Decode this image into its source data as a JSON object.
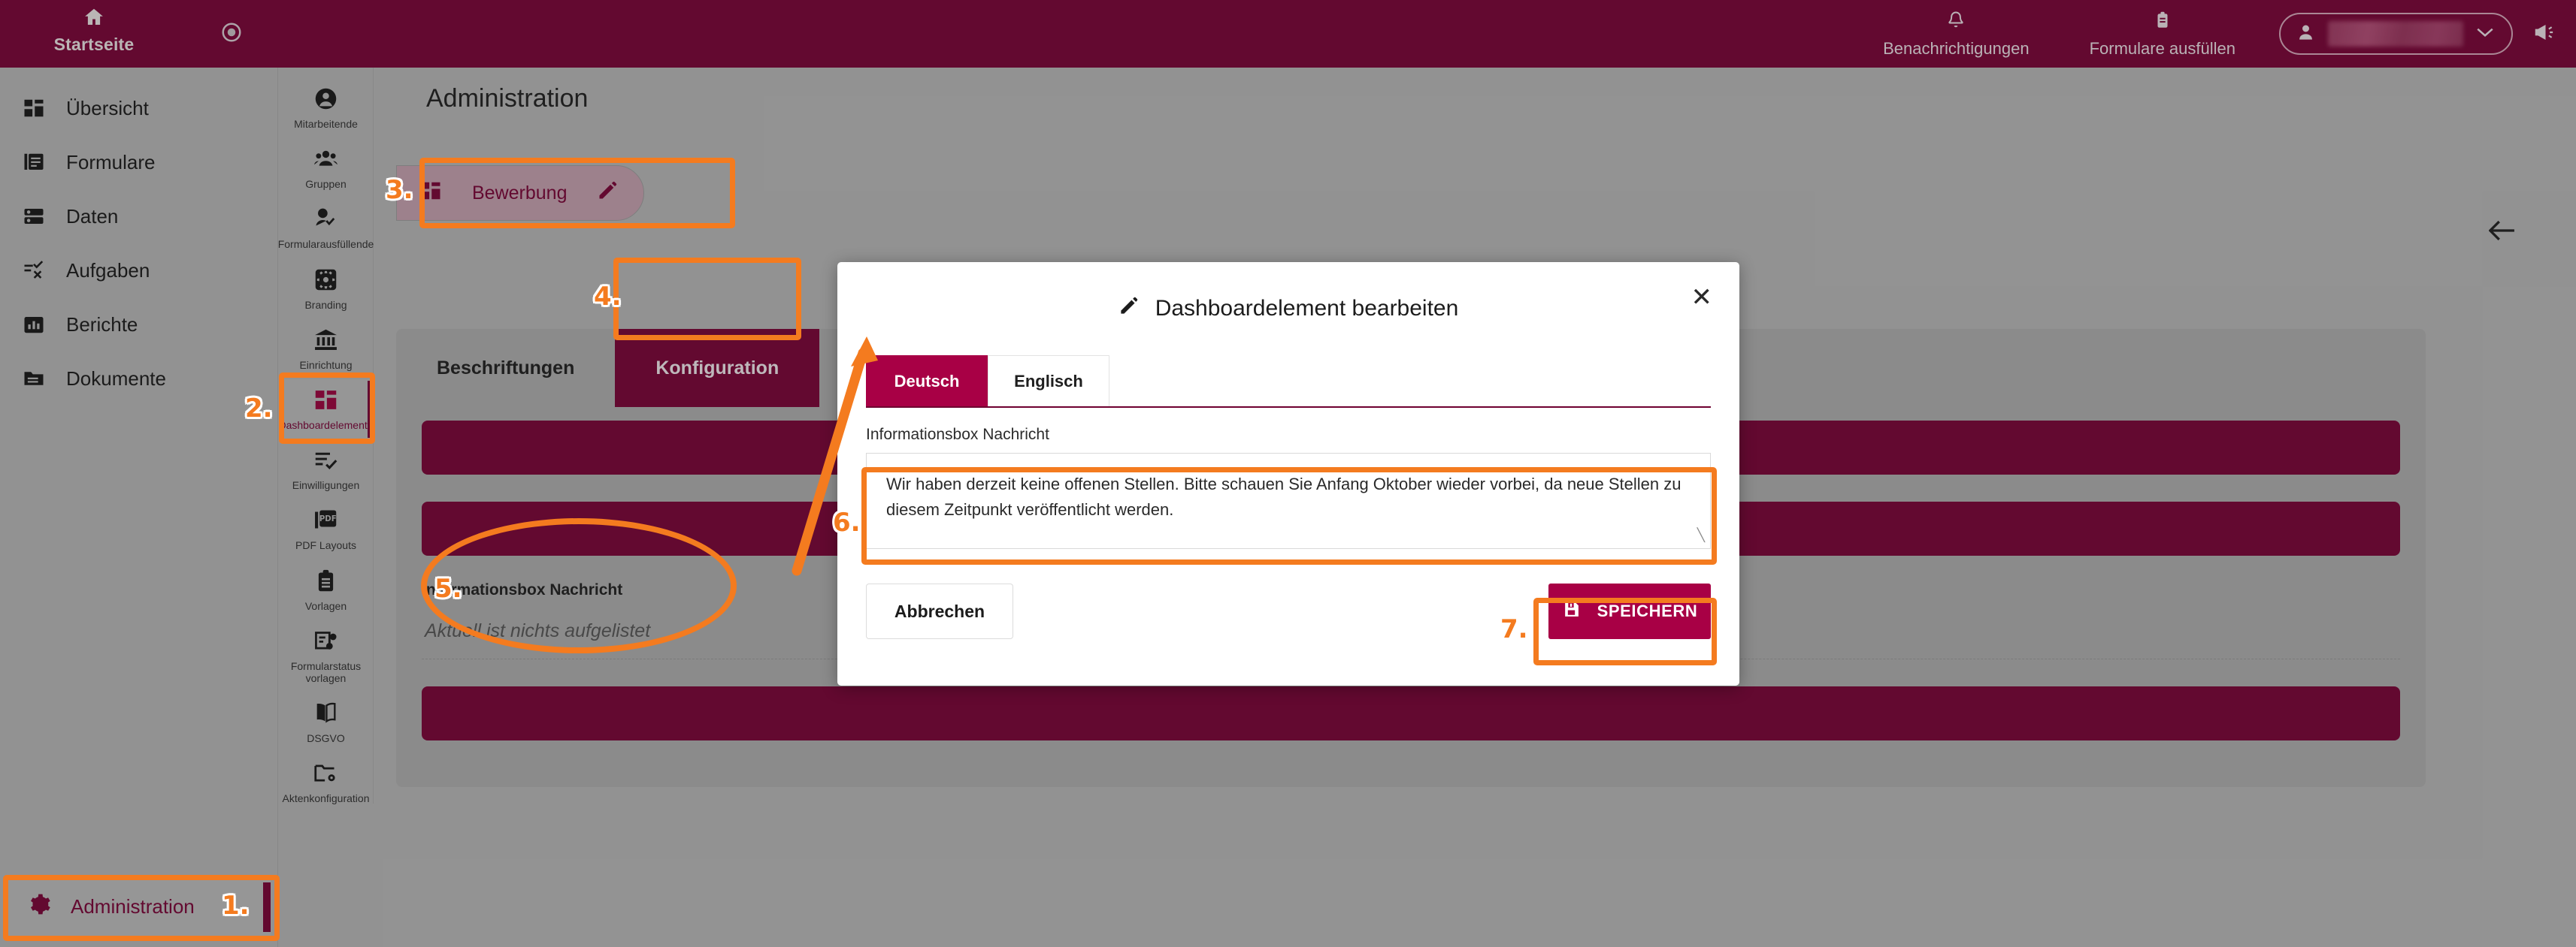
{
  "header": {
    "home_label": "Startseite",
    "target_icon": "target-icon",
    "notifications_label": "Benachrichtigungen",
    "notifications_icon": "bell-icon",
    "fill_forms_label": "Formulare ausfüllen",
    "fill_forms_icon": "clipboard-icon",
    "user_icon": "user-icon",
    "user_name": "",
    "user_chevron": "chevron-down-icon",
    "megaphone_icon": "megaphone-icon",
    "background_color": "#6e0030"
  },
  "sidebar": {
    "items": [
      {
        "label": "Übersicht",
        "icon": "dashboard-grid-icon"
      },
      {
        "label": "Formulare",
        "icon": "forms-icon"
      },
      {
        "label": "Daten",
        "icon": "database-icon"
      },
      {
        "label": "Aufgaben",
        "icon": "tasks-icon"
      },
      {
        "label": "Berichte",
        "icon": "chart-bar-icon"
      },
      {
        "label": "Dokumente",
        "icon": "folder-icon"
      }
    ],
    "admin": {
      "label": "Administration",
      "icon": "gear-icon",
      "active": true
    }
  },
  "icon_column": {
    "items": [
      {
        "label": "Mitarbeitende",
        "icon": "person-circle-icon",
        "active": false
      },
      {
        "label": "Gruppen",
        "icon": "group-icon",
        "active": false
      },
      {
        "label": "Formularausfüllende",
        "icon": "person-check-icon",
        "active": false
      },
      {
        "label": "Branding",
        "icon": "gear-square-icon",
        "active": false
      },
      {
        "label": "Einrichtung",
        "icon": "bank-icon",
        "active": false
      },
      {
        "label": "Dashboardelemente",
        "icon": "dashboard-grid-icon",
        "active": true
      },
      {
        "label": "Einwilligungen",
        "icon": "list-check-icon",
        "active": false
      },
      {
        "label": "PDF Layouts",
        "icon": "pdf-icon",
        "active": false
      },
      {
        "label": "Vorlagen",
        "icon": "clipboard-icon",
        "active": false
      },
      {
        "label": "Formularstatus vorlagen",
        "icon": "workflow-icon",
        "active": false
      },
      {
        "label": "DSGVO",
        "icon": "book-icon",
        "active": false
      },
      {
        "label": "Aktenkonfiguration",
        "icon": "folder-gear-icon",
        "active": false
      }
    ]
  },
  "main": {
    "page_title": "Administration",
    "bewerbung_chip": {
      "label": "Bewerbung",
      "icon": "dashboard-grid-icon",
      "edit_icon": "pencil-icon"
    },
    "tabs": [
      {
        "label": "Beschriftungen",
        "active": false
      },
      {
        "label": "Konfiguration",
        "active": true
      }
    ],
    "infobox": {
      "title": "Informationsbox Nachricht",
      "placeholder": "Aktuell ist nichts aufgelistet"
    },
    "back_icon": "arrow-left-icon"
  },
  "modal": {
    "title": "Dashboardelement bearbeiten",
    "title_icon": "pencil-icon",
    "close_icon": "close-icon",
    "tabs": [
      {
        "label": "Deutsch",
        "active": true
      },
      {
        "label": "Englisch",
        "active": false
      }
    ],
    "field_label": "Informationsbox Nachricht",
    "message_value": "Wir haben derzeit keine offenen Stellen. Bitte schauen Sie Anfang Oktober wieder vorbei, da neue Stellen zu diesem Zeitpunkt veröffentlicht werden.",
    "resize_grip": "resize-grip-icon",
    "cancel_label": "Abbrechen",
    "save_label": "SPEICHERN",
    "save_icon": "save-disk-icon",
    "accent_color": "#a80045"
  },
  "annotations": {
    "highlight_color": "#f47b1f",
    "steps": [
      {
        "number": "1.",
        "target": "Administration"
      },
      {
        "number": "2.",
        "target": "Dashboardelemente"
      },
      {
        "number": "3.",
        "target": "Bewerbung"
      },
      {
        "number": "4.",
        "target": "Konfiguration"
      },
      {
        "number": "5.",
        "target": "Informationsbox Nachricht"
      },
      {
        "number": "6.",
        "target": "Nachricht Textfeld"
      },
      {
        "number": "7.",
        "target": "SPEICHERN"
      }
    ]
  }
}
